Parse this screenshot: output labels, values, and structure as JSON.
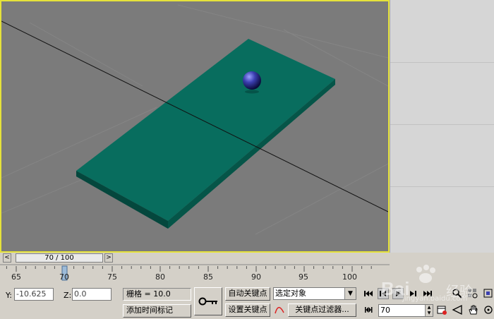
{
  "time_slider": {
    "frame_display": "70 / 100",
    "prev_arrow": "<",
    "next_arrow": ">",
    "current_frame": 70,
    "total_frames": 100
  },
  "ruler": {
    "labels": [
      "65",
      "70",
      "75",
      "80",
      "85",
      "90",
      "95",
      "100"
    ]
  },
  "coords": {
    "y_label": "Y:",
    "y_value": "-10.625",
    "z_label": "Z:",
    "z_value": "0.0"
  },
  "grid_label": "栅格 = 10.0",
  "add_time_tag": "添加时间标记",
  "auto_key": "自动关键点",
  "set_key": "设置关键点",
  "selection_filter": "选定对象",
  "key_filters": "关键点过滤器...",
  "frame_field": "70",
  "watermark": {
    "brand": "Bai",
    "brand2": "经验",
    "url": "jingyan.baidu.com"
  },
  "colors": {
    "viewport_bg": "#7b7b7b",
    "viewport_border": "#e5e23a",
    "plane": "#086d5e",
    "plane_edge": "#04473d",
    "sphere": "#3b3fb0"
  }
}
